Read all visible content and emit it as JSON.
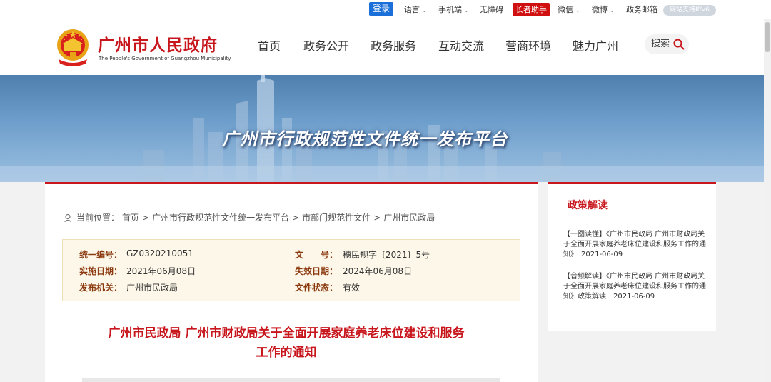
{
  "topbar": {
    "login": "登录",
    "language": "语言",
    "mobile": "手机端",
    "accessibility": "无障碍",
    "elder_assistant": "长者助手",
    "wechat": "微信",
    "weibo": "微博",
    "gov_mail": "政务邮箱",
    "ipv6": "网站支持IPV6"
  },
  "header": {
    "site_name": "广州市人民政府",
    "site_name_en": "The People's Government of Guangzhou Municipality",
    "nav": [
      "首页",
      "政务公开",
      "政务服务",
      "互动交流",
      "营商环境",
      "魅力广州"
    ],
    "search_label": "搜索"
  },
  "banner": {
    "title": "广州市行政规范性文件统一发布平台"
  },
  "breadcrumb": {
    "prefix": "当前位置：",
    "items": [
      "首页",
      "广州市行政规范性文件统一发布平台",
      "市部门规范性文件",
      "广州市民政局"
    ],
    "separator": ">"
  },
  "doc_info": {
    "code_label": "统一编号：",
    "code_value": "GZ0320210051",
    "doc_no_label": "文　　号：",
    "doc_no_value": "穗民规字〔2021〕5号",
    "effective_label": "实施日期：",
    "effective_value": "2021年06月08日",
    "expire_label": "失效日期：",
    "expire_value": "2024年06月08日",
    "issuer_label": "发布机关：",
    "issuer_value": "广州市民政局",
    "status_label": "文件状态：",
    "status_value": "有效"
  },
  "document": {
    "title_line1": "广州市民政局 广州市财政局关于全面开展家庭养老床位建设和服务",
    "title_line2": "工作的通知"
  },
  "sidebar": {
    "title": "政策解读",
    "items": [
      "【一图读懂】《广州市民政局 广州市财政局关于全面开展家庭养老床位建设和服务工作的通知》　2021-06-09",
      "【音频解读】《广州市民政局 广州市财政局关于全面开展家庭养老床位建设和服务工作的通知》政策解读　2021-06-09"
    ]
  },
  "colors": {
    "brand_red": "#c8161d",
    "login_blue": "#1a6fd8",
    "info_bg": "#fdf7e9"
  }
}
